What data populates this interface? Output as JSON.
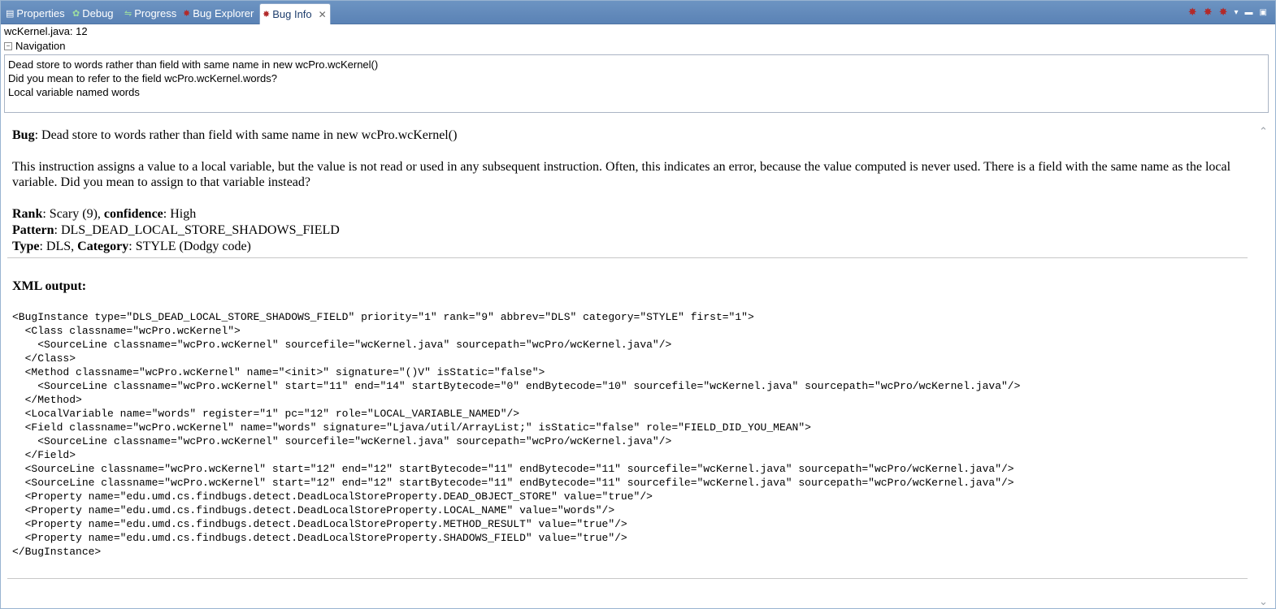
{
  "tabs": [
    {
      "label": "Properties",
      "icon": "properties-icon"
    },
    {
      "label": "Debug",
      "icon": "debug-icon"
    },
    {
      "label": "Progress",
      "icon": "progress-icon"
    },
    {
      "label": "Bug Explorer",
      "icon": "bug-icon"
    },
    {
      "label": "Bug Info",
      "icon": "bug-icon",
      "active": true
    }
  ],
  "file_header": "wcKernel.java: 12",
  "navigation": {
    "label": "Navigation",
    "items": [
      "Dead store to words rather than field with same name in new wcPro.wcKernel()",
      "Did you mean to refer to the field wcPro.wcKernel.words?",
      "Local variable named words"
    ]
  },
  "bug": {
    "label": "Bug",
    "text": ": Dead store to words rather than field with same name in new wcPro.wcKernel()",
    "description": "This instruction assigns a value to a local variable, but the value is not read or used in any subsequent instruction. Often, this indicates an error, because the value computed is never used. There is a field with the same name as the local variable. Did you mean to assign to that variable instead?",
    "rank_label": "Rank",
    "rank_value": ": Scary (9), ",
    "confidence_label": "confidence",
    "confidence_value": ": High",
    "pattern_label": "Pattern",
    "pattern_value": ": DLS_DEAD_LOCAL_STORE_SHADOWS_FIELD",
    "type_label": "Type",
    "type_value": ": DLS, ",
    "category_label": "Category",
    "category_value": ": STYLE (Dodgy code)"
  },
  "xml_heading": "XML output:",
  "xml_lines": [
    "<BugInstance type=\"DLS_DEAD_LOCAL_STORE_SHADOWS_FIELD\" priority=\"1\" rank=\"9\" abbrev=\"DLS\" category=\"STYLE\" first=\"1\">",
    "  <Class classname=\"wcPro.wcKernel\">",
    "    <SourceLine classname=\"wcPro.wcKernel\" sourcefile=\"wcKernel.java\" sourcepath=\"wcPro/wcKernel.java\"/>",
    "  </Class>",
    "  <Method classname=\"wcPro.wcKernel\" name=\"<init>\" signature=\"()V\" isStatic=\"false\">",
    "    <SourceLine classname=\"wcPro.wcKernel\" start=\"11\" end=\"14\" startBytecode=\"0\" endBytecode=\"10\" sourcefile=\"wcKernel.java\" sourcepath=\"wcPro/wcKernel.java\"/>",
    "  </Method>",
    "  <LocalVariable name=\"words\" register=\"1\" pc=\"12\" role=\"LOCAL_VARIABLE_NAMED\"/>",
    "  <Field classname=\"wcPro.wcKernel\" name=\"words\" signature=\"Ljava/util/ArrayList;\" isStatic=\"false\" role=\"FIELD_DID_YOU_MEAN\">",
    "    <SourceLine classname=\"wcPro.wcKernel\" sourcefile=\"wcKernel.java\" sourcepath=\"wcPro/wcKernel.java\"/>",
    "  </Field>",
    "  <SourceLine classname=\"wcPro.wcKernel\" start=\"12\" end=\"12\" startBytecode=\"11\" endBytecode=\"11\" sourcefile=\"wcKernel.java\" sourcepath=\"wcPro/wcKernel.java\"/>",
    "  <SourceLine classname=\"wcPro.wcKernel\" start=\"12\" end=\"12\" startBytecode=\"11\" endBytecode=\"11\" sourcefile=\"wcKernel.java\" sourcepath=\"wcPro/wcKernel.java\"/>",
    "  <Property name=\"edu.umd.cs.findbugs.detect.DeadLocalStoreProperty.DEAD_OBJECT_STORE\" value=\"true\"/>",
    "  <Property name=\"edu.umd.cs.findbugs.detect.DeadLocalStoreProperty.LOCAL_NAME\" value=\"words\"/>",
    "  <Property name=\"edu.umd.cs.findbugs.detect.DeadLocalStoreProperty.METHOD_RESULT\" value=\"true\"/>",
    "  <Property name=\"edu.umd.cs.findbugs.detect.DeadLocalStoreProperty.SHADOWS_FIELD\" value=\"true\"/>",
    "</BugInstance>"
  ],
  "toolbar_icons": [
    "bug-icon",
    "bug-icon",
    "bug-icon",
    "view-menu-icon",
    "minimize-icon",
    "maximize-icon"
  ],
  "colors": {
    "tabbar": "#5a82b5",
    "active_tab_text": "#1f3f6e",
    "bug_icon": "#b22a2a"
  }
}
